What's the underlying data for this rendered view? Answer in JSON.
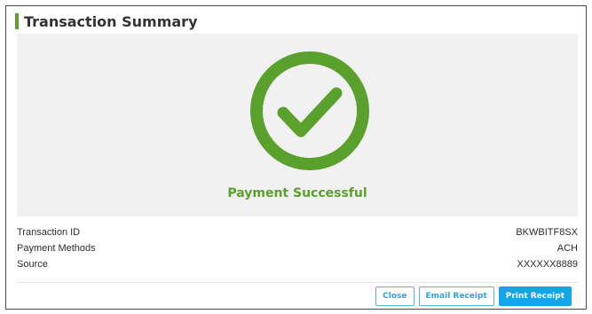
{
  "dialog": {
    "title": "Transaction Summary",
    "accent_color": "#5aa02c"
  },
  "status": {
    "icon": "check-circle-icon",
    "message": "Payment Successful",
    "color": "#5aa02c"
  },
  "details": [
    {
      "label": "Transaction ID",
      "value": "BKWBITF8SX"
    },
    {
      "label": "Payment Methods",
      "value": "ACH"
    },
    {
      "label": "Source",
      "value": "XXXXXX8889"
    }
  ],
  "actions": {
    "close_label": "Close",
    "email_label": "Email Receipt",
    "print_label": "Print Receipt",
    "primary_color": "#14a4ea"
  }
}
